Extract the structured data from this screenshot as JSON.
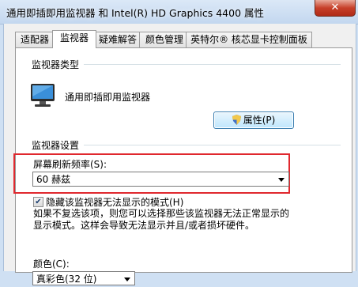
{
  "window": {
    "title": "通用即插即用监视器 和 Intel(R) HD Graphics 4400 属性",
    "close_symbol": "✕"
  },
  "tabs": [
    {
      "label": "适配器"
    },
    {
      "label": "监视器"
    },
    {
      "label": "疑难解答"
    },
    {
      "label": "颜色管理"
    },
    {
      "label": "英特尔® 核芯显卡控制面板"
    }
  ],
  "monitor_type": {
    "heading": "监视器类型",
    "name": "通用即插即用监视器",
    "properties_label": "属性(P)"
  },
  "monitor_settings": {
    "heading": "监视器设置",
    "refresh_label": "屏幕刷新频率(S):",
    "refresh_value": "60 赫兹",
    "hide_modes_checked": true,
    "hide_modes_label": "隐藏该监视器无法显示的模式(H)",
    "description": "如果不复选该项，则您可以选择那些该监视器无法正常显示的显示模式。这样会导致无法显示并且/或者损坏硬件。"
  },
  "colors": {
    "label": "颜色(C):",
    "value": "真彩色(32 位)"
  }
}
